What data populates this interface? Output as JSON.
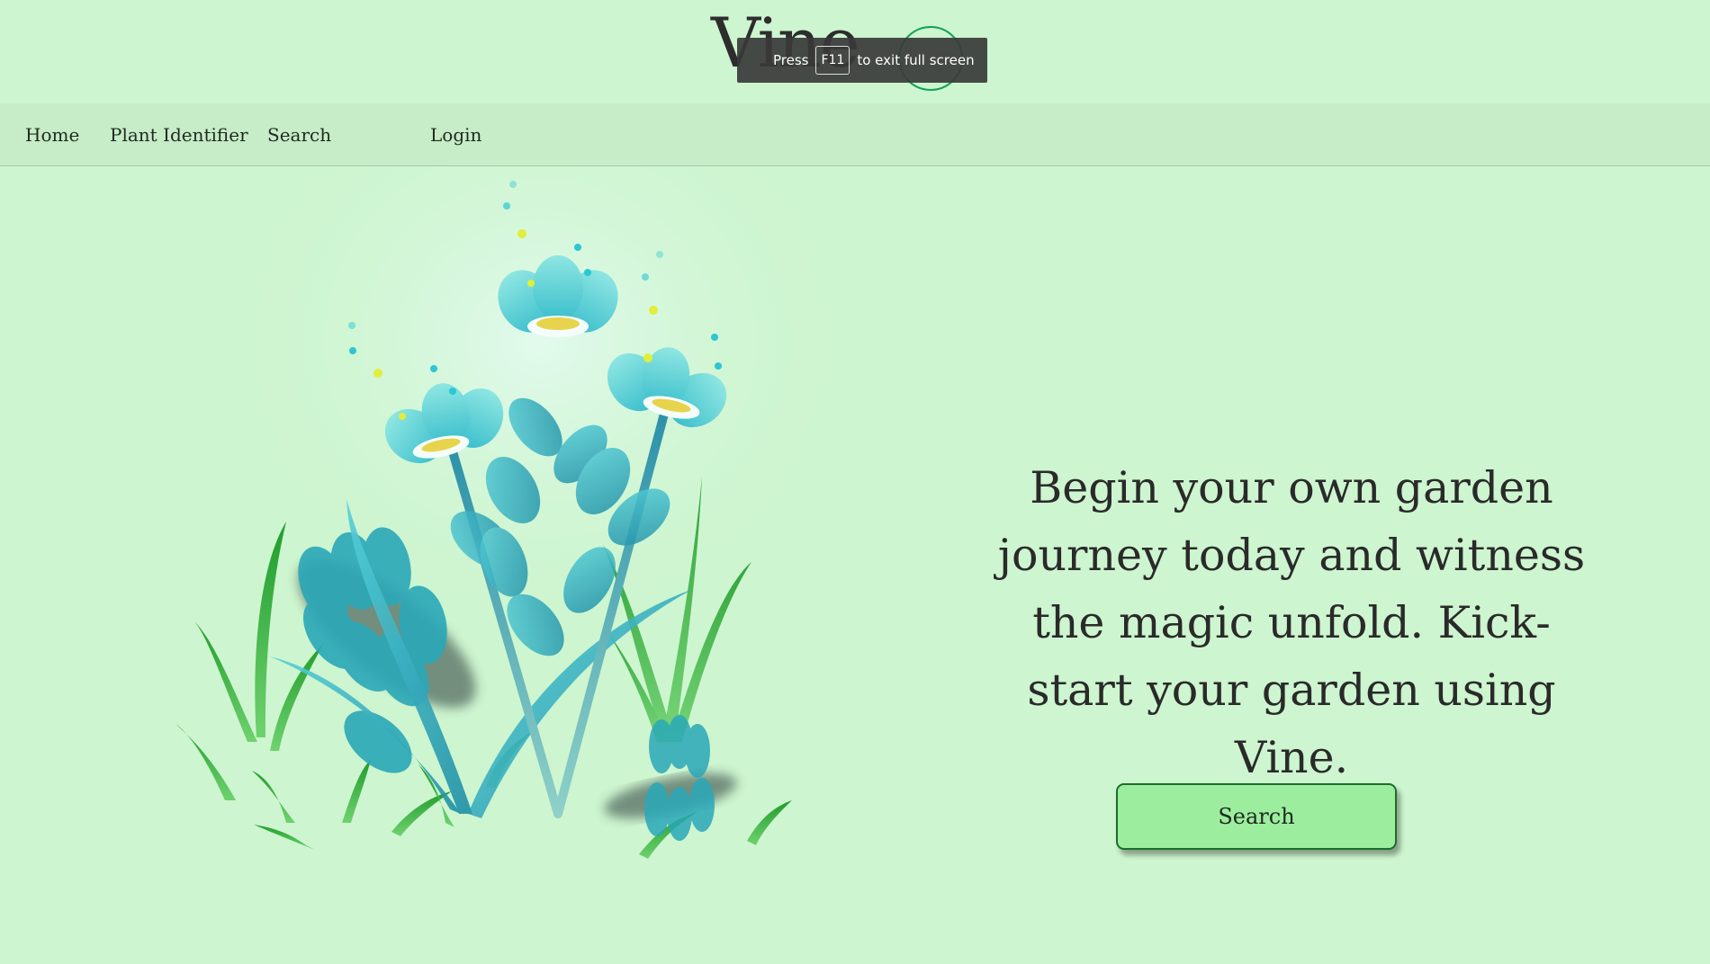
{
  "brand": {
    "logo_text": "Vine"
  },
  "fullscreen_toast": {
    "press": "Press",
    "key": "F11",
    "suffix": "to exit full screen"
  },
  "nav": {
    "items": [
      {
        "label": "Home"
      },
      {
        "label": "Plant Identifier"
      },
      {
        "label": "Search"
      },
      {
        "label": "Login"
      }
    ]
  },
  "hero": {
    "headline": "Begin your own garden journey today and witness the magic unfold. Kick-start your garden using Vine.",
    "cta_label": "Search",
    "illustration_icon": "flower-garden-illustration"
  },
  "colors": {
    "background": "#cdf5cf",
    "navbar": "#c7ecc8",
    "button": "#9cee9e",
    "button_border": "#1b6e2b",
    "petal": "#4fd2d8",
    "grass": "#2fae3c"
  }
}
